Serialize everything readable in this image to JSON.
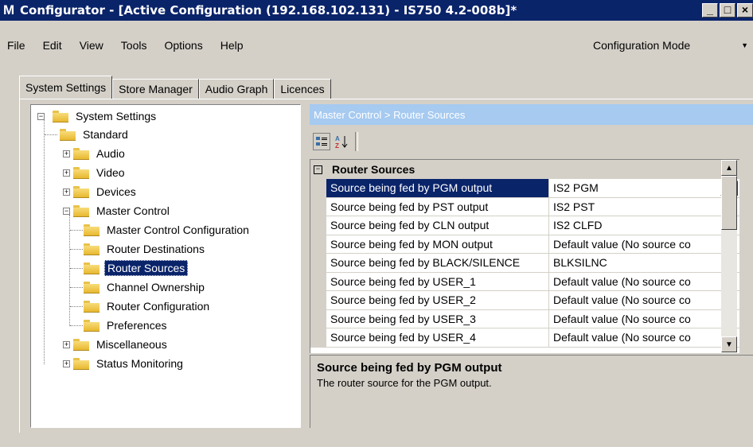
{
  "window": {
    "title": "Configurator - [Active Configuration (192.168.102.131) - IS750 4.2-008b]*",
    "logo": "M"
  },
  "menu": [
    "File",
    "Edit",
    "View",
    "Tools",
    "Options",
    "Help"
  ],
  "mode_select": {
    "value": "Configuration Mode"
  },
  "tabs": [
    "System Settings",
    "Store Manager",
    "Audio Graph",
    "Licences"
  ],
  "tree": {
    "root": "System Settings",
    "items": [
      "Standard",
      "Audio",
      "Video",
      "Devices",
      "Master Control",
      "Master Control Configuration",
      "Router Destinations",
      "Router Sources",
      "Channel Ownership",
      "Router Configuration",
      "Preferences",
      "Miscellaneous",
      "Status Monitoring"
    ]
  },
  "breadcrumb": "Master Control > Router Sources",
  "grid": {
    "category": "Router Sources",
    "rows": [
      {
        "name": "Source being fed by PGM output",
        "value": "IS2 PGM"
      },
      {
        "name": "Source being fed by PST output",
        "value": "IS2 PST"
      },
      {
        "name": "Source being fed by CLN output",
        "value": "IS2 CLFD"
      },
      {
        "name": "Source being fed by MON output",
        "value": "Default value (No source co"
      },
      {
        "name": "Source being fed by BLACK/SILENCE",
        "value": "BLKSILNC"
      },
      {
        "name": "Source being fed by USER_1",
        "value": "Default value (No source co"
      },
      {
        "name": "Source being fed by USER_2",
        "value": "Default value (No source co"
      },
      {
        "name": "Source being fed by USER_3",
        "value": "Default value (No source co"
      },
      {
        "name": "Source being fed by USER_4",
        "value": "Default value (No source co"
      }
    ]
  },
  "help": {
    "title": "Source being fed by PGM output",
    "description": "The router source for the PGM output."
  },
  "ellipsis": "...",
  "tree_expander": {
    "plus": "+",
    "minus": "−"
  }
}
